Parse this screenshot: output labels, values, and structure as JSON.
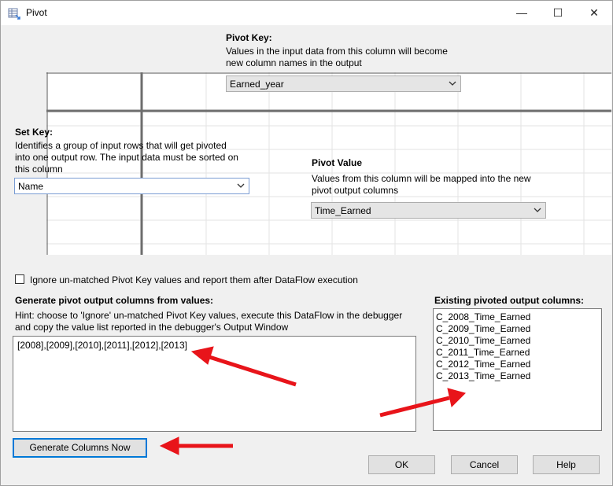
{
  "window": {
    "title": "Pivot"
  },
  "titlebar_buttons": {
    "minimize": "—",
    "maximize": "☐",
    "close": "✕"
  },
  "pivot_key": {
    "label": "Pivot Key:",
    "description_line1": "Values in the input data from this column will become",
    "description_line2": "new column names in the output",
    "value": "Earned_year"
  },
  "set_key": {
    "label": "Set Key:",
    "description_line1": "Identifies a group of input rows that will get pivoted",
    "description_line2": "into one output row. The input data must be sorted on",
    "description_line3": "this column",
    "value": "Name"
  },
  "pivot_value": {
    "label": "Pivot Value",
    "description_line1": "Values from this column will be mapped into the new",
    "description_line2": "pivot output columns",
    "value": "Time_Earned"
  },
  "ignore_checkbox": {
    "label": "Ignore un-matched Pivot Key values and report them after DataFlow execution",
    "checked": false
  },
  "generate_section": {
    "label": "Generate pivot output columns from values:",
    "hint_line1": "Hint: choose to 'Ignore' un-matched Pivot Key values, execute this DataFlow in the debugger",
    "hint_line2": "and copy the value list reported in the debugger's Output Window",
    "values_text": "[2008],[2009],[2010],[2011],[2012],[2013]",
    "button_label": "Generate Columns Now"
  },
  "existing_section": {
    "label": "Existing pivoted output columns:",
    "columns": [
      "C_2008_Time_Earned",
      "C_2009_Time_Earned",
      "C_2010_Time_Earned",
      "C_2011_Time_Earned",
      "C_2012_Time_Earned",
      "C_2013_Time_Earned"
    ]
  },
  "footer": {
    "ok": "OK",
    "cancel": "Cancel",
    "help": "Help"
  },
  "annotation_color": "#e8141a"
}
